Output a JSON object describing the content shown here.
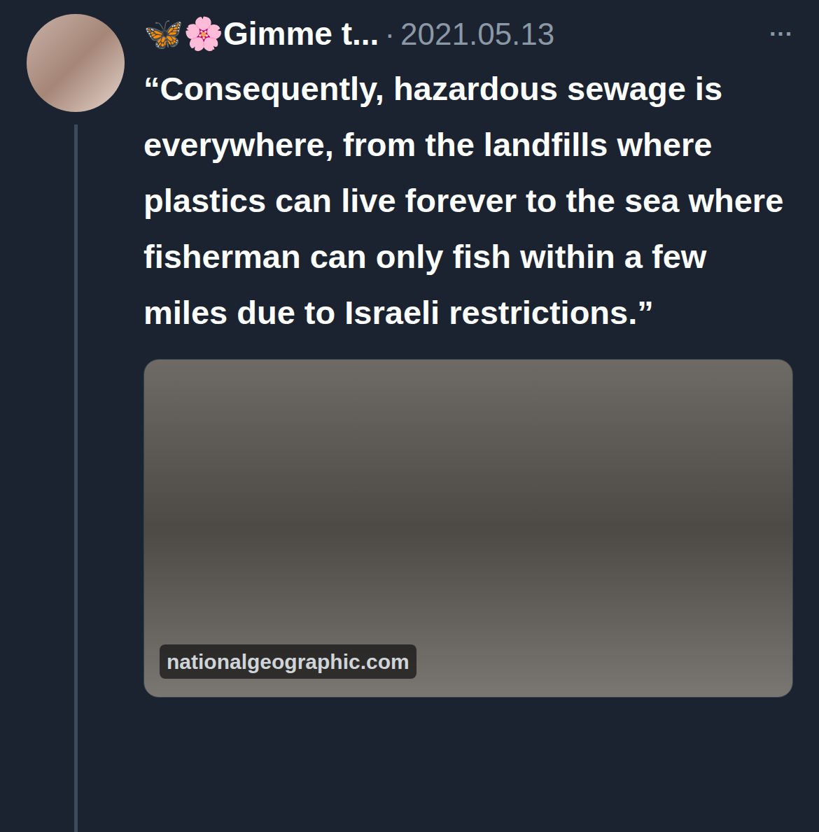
{
  "post": {
    "author": "🦋🌸Gimme t...",
    "separator": "·",
    "date": "2021.05.13",
    "more": "···",
    "text": "“Consequently, hazardous sewage is everywhere, from the landfills where plastics can live forever to the sea where fisherman can only fish within a few miles due to Israeli restrictions.”",
    "card": {
      "domain": "nationalgeographic.com"
    }
  }
}
